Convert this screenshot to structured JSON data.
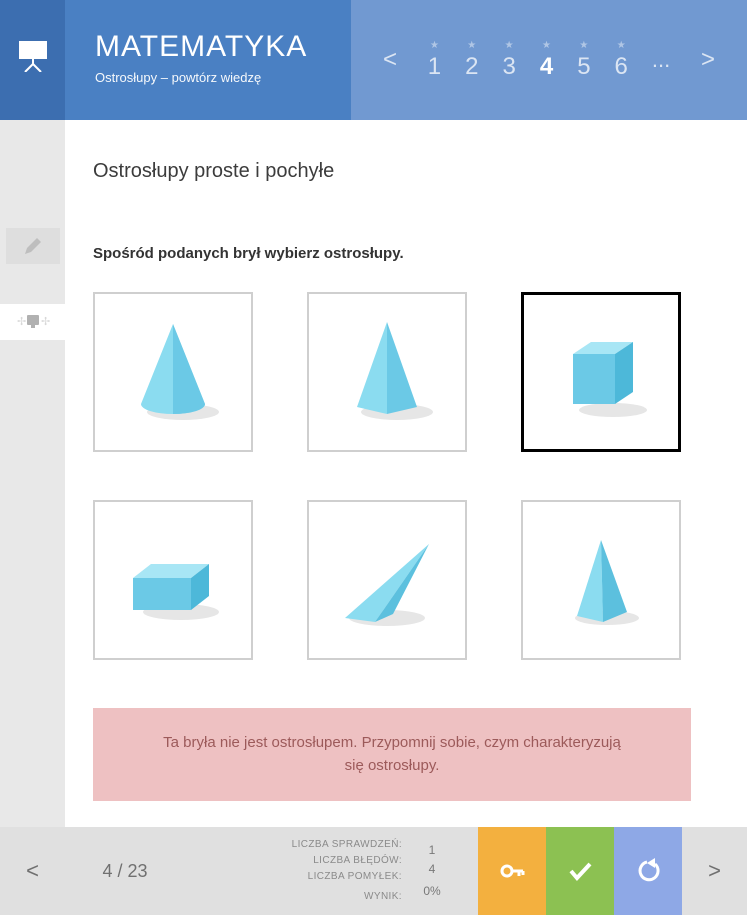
{
  "header": {
    "title": "MATEMATYKA",
    "subtitle": "Ostrosłupy – powtórz wiedzę",
    "nav": {
      "prev": "<",
      "next": ">",
      "pages": [
        "1",
        "2",
        "3",
        "4",
        "5",
        "6"
      ],
      "ellipsis": "...",
      "current": "4"
    }
  },
  "content": {
    "section_title": "Ostrosłupy proste i pochyłe",
    "question": "Spośród podanych brył wybierz ostrosłupy.",
    "feedback": "Ta bryła nie jest ostrosłupem. Przypomnij sobie, czym charakteryzują się ostrosłupy."
  },
  "options": [
    {
      "id": "cone",
      "selected": false
    },
    {
      "id": "square-pyramid",
      "selected": false
    },
    {
      "id": "cube",
      "selected": true
    },
    {
      "id": "cuboid",
      "selected": false
    },
    {
      "id": "oblique-pyramid",
      "selected": false
    },
    {
      "id": "triangular-pyramid",
      "selected": false
    }
  ],
  "footer": {
    "prev": "<",
    "next": ">",
    "progress": "4 / 23",
    "stats": {
      "checks_label": "LICZBA SPRAWDZEŃ:",
      "errors_label": "LICZBA BŁĘDÓW:",
      "mistakes_label": "LICZBA POMYŁEK:",
      "checks_value": "",
      "errors_value": "1",
      "mistakes_value": "4",
      "score_label": "WYNIK:",
      "score_value": "0%"
    }
  }
}
